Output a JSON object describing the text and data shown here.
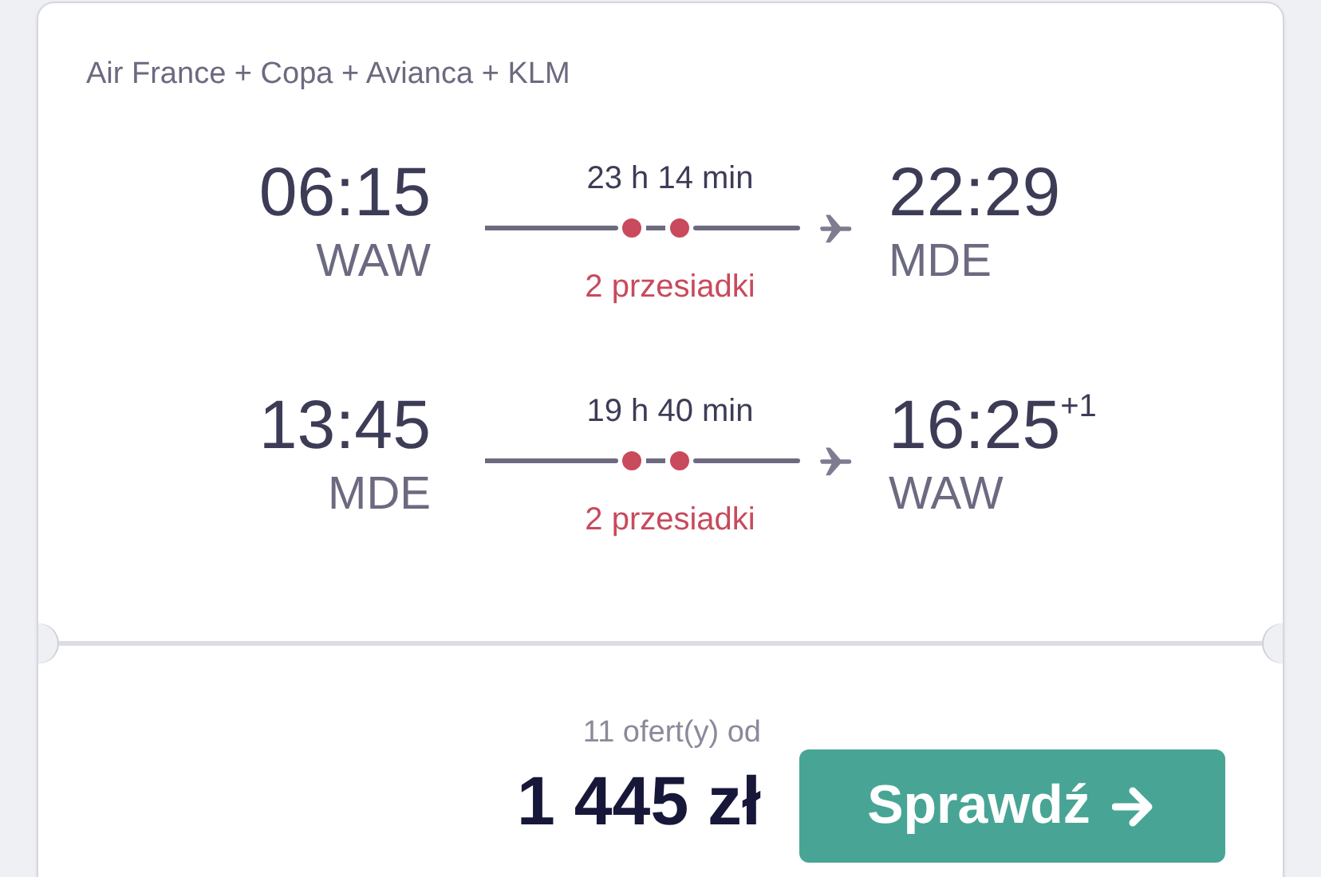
{
  "carriers": "Air France + Copa + Avianca + KLM",
  "legs": [
    {
      "depart_time": "06:15",
      "depart_airport": "WAW",
      "duration": "23 h 14 min",
      "stops": "2 przesiadki",
      "arrive_time": "22:29",
      "arrive_airport": "MDE"
    },
    {
      "depart_time": "13:45",
      "depart_airport": "MDE",
      "duration": "19 h 40 min",
      "stops": "2 przesiadki",
      "arrive_time": "16:25$^{+1}$",
      "arrive_airport": "WAW"
    }
  ],
  "offers": "11 ofert(y) od",
  "price": "1 445 zł",
  "button": "Sprawdź"
}
